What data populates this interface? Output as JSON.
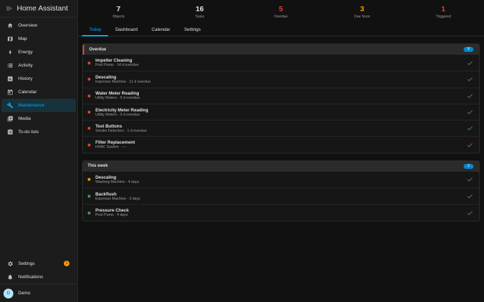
{
  "app": {
    "title": "Home Assistant"
  },
  "sidebar": {
    "items": [
      {
        "label": "Overview",
        "icon": "view-dashboard-icon"
      },
      {
        "label": "Map",
        "icon": "map-icon"
      },
      {
        "label": "Energy",
        "icon": "lightning-icon"
      },
      {
        "label": "Activity",
        "icon": "list-icon"
      },
      {
        "label": "History",
        "icon": "chart-box-icon"
      },
      {
        "label": "Calendar",
        "icon": "calendar-icon"
      },
      {
        "label": "Maintenance",
        "icon": "wrench-icon",
        "active": true
      },
      {
        "label": "Media",
        "icon": "media-icon"
      },
      {
        "label": "To-do lists",
        "icon": "clipboard-list-icon"
      }
    ],
    "settings": {
      "label": "Settings",
      "badge": "1"
    },
    "notifications": {
      "label": "Notifications"
    },
    "user": {
      "initial": "D",
      "name": "Demo"
    }
  },
  "stats": {
    "objects": {
      "value": "7",
      "label": "Objects"
    },
    "tasks": {
      "value": "16",
      "label": "Tasks"
    },
    "overdue": {
      "value": "5",
      "label": "Overdue"
    },
    "due_soon": {
      "value": "3",
      "label": "Due Soon"
    },
    "triggered": {
      "value": "1",
      "label": "Triggered"
    }
  },
  "tabs": [
    "Today",
    "Dashboard",
    "Calendar",
    "Settings"
  ],
  "sections": {
    "overdue": {
      "title": "Overdue",
      "count": "6",
      "items": [
        {
          "title": "Impeller Cleaning",
          "subtitle": "Pool Pump · 14 d overdue",
          "status": "red"
        },
        {
          "title": "Descaling",
          "subtitle": "Espresso Machine · 11 d overdue",
          "status": "red"
        },
        {
          "title": "Water Meter Reading",
          "subtitle": "Utility Meters · 5 d overdue",
          "status": "red"
        },
        {
          "title": "Electricity Meter Reading",
          "subtitle": "Utility Meters · 5 d overdue",
          "status": "red"
        },
        {
          "title": "Test Buttons",
          "subtitle": "Smoke Detectors · 1 d overdue",
          "status": "red"
        },
        {
          "title": "Filter Replacement",
          "subtitle": "HVAC System · —",
          "status": "red"
        }
      ]
    },
    "this_week": {
      "title": "This week",
      "count": "3",
      "items": [
        {
          "title": "Descaling",
          "subtitle": "Washing Machine · 4 days",
          "status": "orange"
        },
        {
          "title": "Backflush",
          "subtitle": "Espresso Machine · 3 days",
          "status": "green"
        },
        {
          "title": "Pressure Check",
          "subtitle": "Pool Pump · 4 days",
          "status": "green"
        }
      ]
    }
  },
  "colors": {
    "accent": "#03a9f4",
    "overdue": "#db4437",
    "due_soon": "#ff9800",
    "ok": "#43a047"
  }
}
